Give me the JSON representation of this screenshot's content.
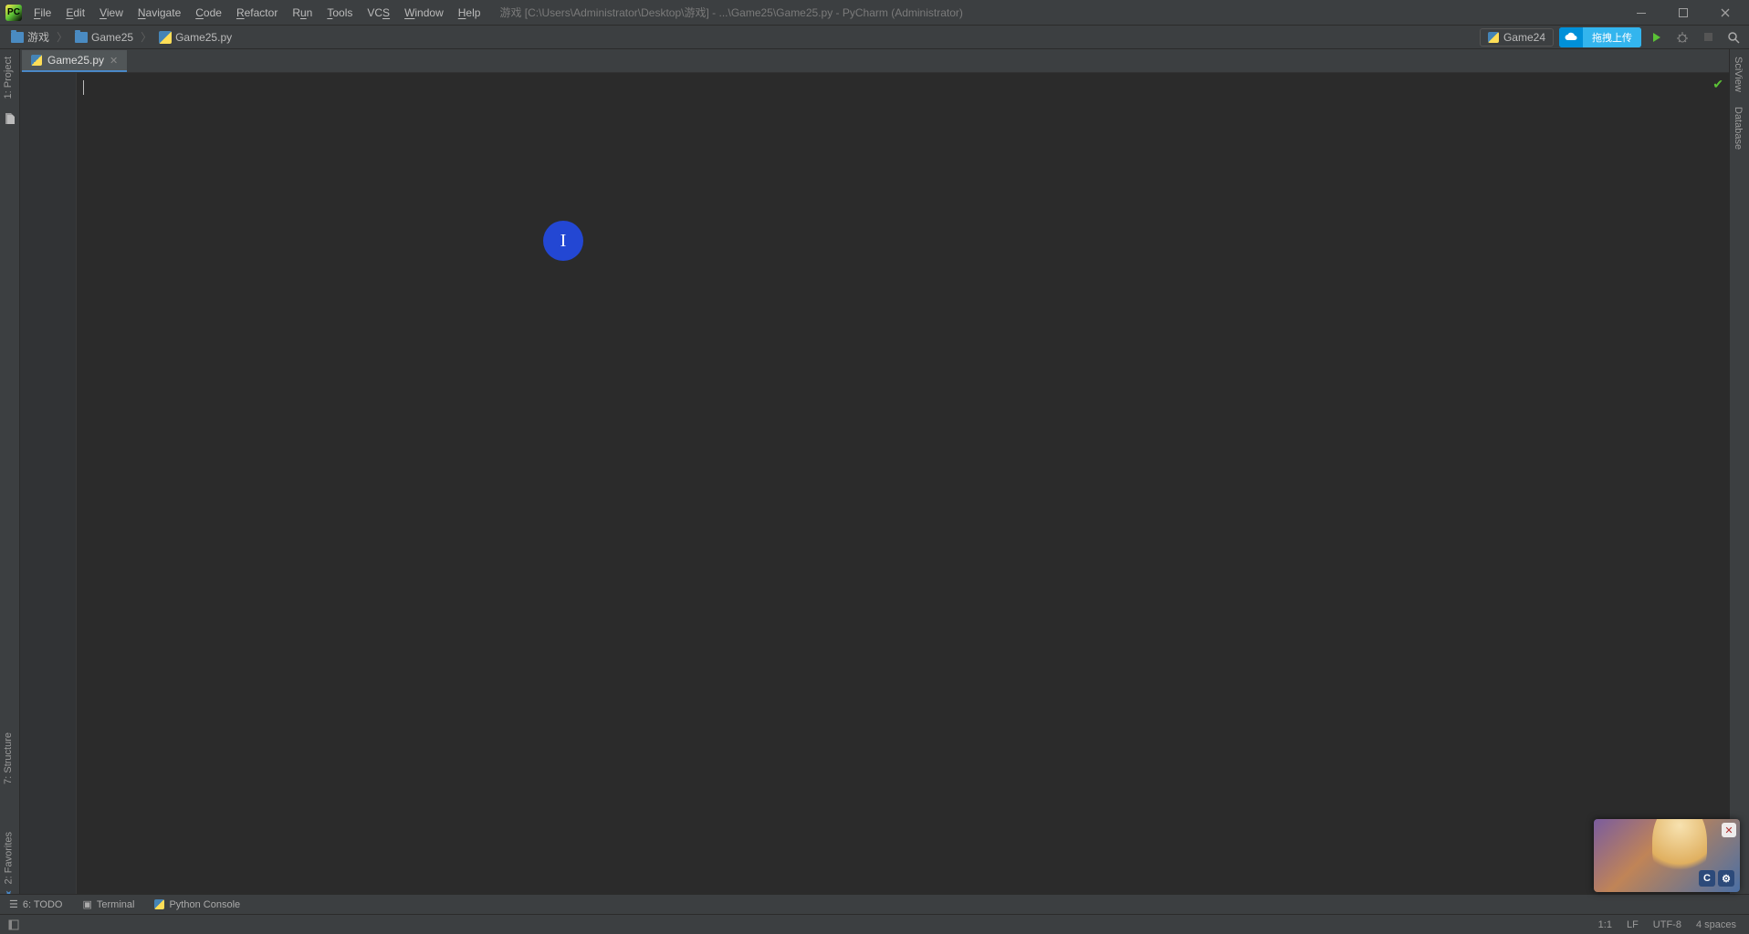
{
  "menu": {
    "file": "File",
    "edit": "Edit",
    "view": "View",
    "navigate": "Navigate",
    "code": "Code",
    "refactor": "Refactor",
    "run": "Run",
    "tools": "Tools",
    "vcs": "VCS",
    "window": "Window",
    "help": "Help"
  },
  "title": "游戏 [C:\\Users\\Administrator\\Desktop\\游戏] - ...\\Game25\\Game25.py - PyCharm (Administrator)",
  "breadcrumbs": {
    "root": "游戏",
    "folder": "Game25",
    "file": "Game25.py"
  },
  "run_config": "Game24",
  "cloud_upload_label": "拖拽上传",
  "tab": {
    "name": "Game25.py"
  },
  "left_tools": {
    "project": "1: Project",
    "structure": "7: Structure",
    "favorites": "2: Favorites"
  },
  "right_tools": {
    "sciview": "SciView",
    "database": "Database"
  },
  "bottom_tools": {
    "todo": "6: TODO",
    "terminal": "Terminal",
    "python_console": "Python Console"
  },
  "status": {
    "position": "1:1",
    "line_ending": "LF",
    "encoding": "UTF-8",
    "indent": "4 spaces"
  },
  "float": {
    "badge1": "C",
    "badge2": "⚙"
  }
}
